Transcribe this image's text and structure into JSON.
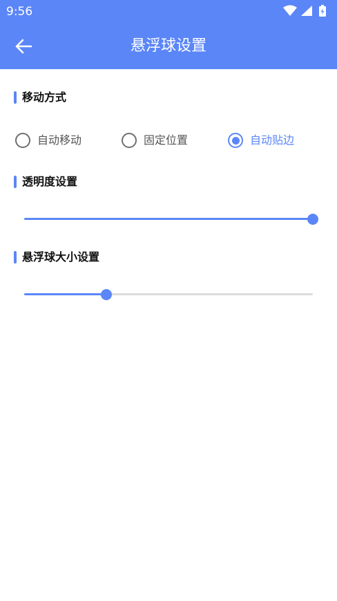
{
  "status_bar": {
    "time": "9:56",
    "icons": [
      "wifi-icon",
      "signal-icon",
      "battery-charging-icon"
    ]
  },
  "app_bar": {
    "title": "悬浮球设置",
    "back_icon": "arrow-left-icon",
    "background_color": "#5b86f7"
  },
  "sections": {
    "movement": {
      "title": "移动方式",
      "options": [
        {
          "label": "自动移动",
          "checked": false
        },
        {
          "label": "固定位置",
          "checked": false
        },
        {
          "label": "自动贴边",
          "checked": true
        }
      ]
    },
    "opacity": {
      "title": "透明度设置",
      "value_fraction": 1.0
    },
    "size": {
      "title": "悬浮球大小设置",
      "value_fraction": 0.285
    }
  },
  "colors": {
    "accent": "#5b86f7",
    "inactive_radio": "#6e6e6e",
    "track": "#dcdcdc"
  }
}
